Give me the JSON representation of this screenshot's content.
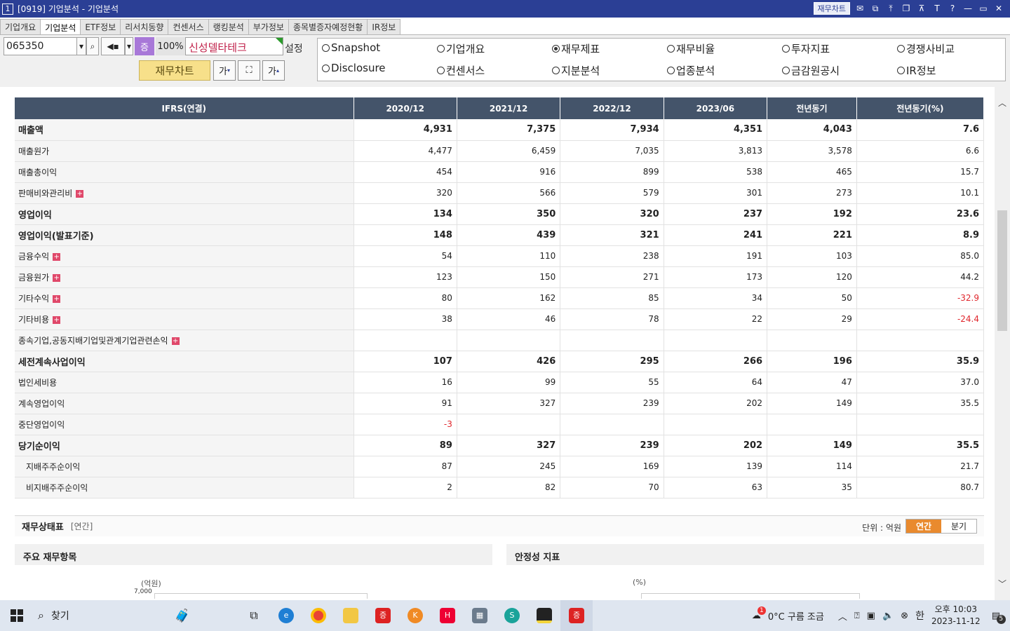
{
  "window": {
    "number": "1",
    "title": "[0919] 기업분석 - 기업분석",
    "chart_button": "재무차트"
  },
  "tabs": [
    "기업개요",
    "기업분석",
    "ETF정보",
    "리서치동향",
    "컨센서스",
    "랭킹분석",
    "부가정보",
    "종목별증자예정현황",
    "IR정보"
  ],
  "controls": {
    "code": "065350",
    "zoom_icon": "증",
    "zoom_pct": "100%",
    "company": "신성델타테크",
    "settings": "설정",
    "fin_chart_button": "재무차트",
    "font_small": "가",
    "font_large": "가"
  },
  "radios": [
    {
      "label": "Snapshot",
      "selected": false
    },
    {
      "label": "기업개요",
      "selected": false
    },
    {
      "label": "재무제표",
      "selected": true
    },
    {
      "label": "재무비율",
      "selected": false
    },
    {
      "label": "투자지표",
      "selected": false
    },
    {
      "label": "경쟁사비교",
      "selected": false
    },
    {
      "label": "Disclosure",
      "selected": false
    },
    {
      "label": "컨센서스",
      "selected": false
    },
    {
      "label": "지분분석",
      "selected": false
    },
    {
      "label": "업종분석",
      "selected": false
    },
    {
      "label": "금감원공시",
      "selected": false
    },
    {
      "label": "IR정보",
      "selected": false
    }
  ],
  "table": {
    "headers": [
      "IFRS(연결)",
      "2020/12",
      "2021/12",
      "2022/12",
      "2023/06",
      "전년동기",
      "전년동기(%)"
    ],
    "rows": [
      {
        "label": "매출액",
        "bold": true,
        "plus": false,
        "values": [
          "4,931",
          "7,375",
          "7,934",
          "4,351",
          "4,043",
          "7.6"
        ]
      },
      {
        "label": "매출원가",
        "bold": false,
        "plus": false,
        "values": [
          "4,477",
          "6,459",
          "7,035",
          "3,813",
          "3,578",
          "6.6"
        ]
      },
      {
        "label": "매출총이익",
        "bold": false,
        "plus": false,
        "values": [
          "454",
          "916",
          "899",
          "538",
          "465",
          "15.7"
        ]
      },
      {
        "label": "판매비와관리비",
        "bold": false,
        "plus": true,
        "values": [
          "320",
          "566",
          "579",
          "301",
          "273",
          "10.1"
        ]
      },
      {
        "label": "영업이익",
        "bold": true,
        "plus": false,
        "values": [
          "134",
          "350",
          "320",
          "237",
          "192",
          "23.6"
        ]
      },
      {
        "label": "영업이익(발표기준)",
        "bold": true,
        "plus": false,
        "values": [
          "148",
          "439",
          "321",
          "241",
          "221",
          "8.9"
        ]
      },
      {
        "label": "금융수익",
        "bold": false,
        "plus": true,
        "values": [
          "54",
          "110",
          "238",
          "191",
          "103",
          "85.0"
        ]
      },
      {
        "label": "금융원가",
        "bold": false,
        "plus": true,
        "values": [
          "123",
          "150",
          "271",
          "173",
          "120",
          "44.2"
        ]
      },
      {
        "label": "기타수익",
        "bold": false,
        "plus": true,
        "values": [
          "80",
          "162",
          "85",
          "34",
          "50",
          "-32.9"
        ]
      },
      {
        "label": "기타비용",
        "bold": false,
        "plus": true,
        "values": [
          "38",
          "46",
          "78",
          "22",
          "29",
          "-24.4"
        ]
      },
      {
        "label": "종속기업,공동지배기업및관계기업관련손익",
        "bold": false,
        "plus": true,
        "values": [
          "",
          "",
          "",
          "",
          "",
          ""
        ]
      },
      {
        "label": "세전계속사업이익",
        "bold": true,
        "plus": false,
        "values": [
          "107",
          "426",
          "295",
          "266",
          "196",
          "35.9"
        ]
      },
      {
        "label": "법인세비용",
        "bold": false,
        "plus": false,
        "values": [
          "16",
          "99",
          "55",
          "64",
          "47",
          "37.0"
        ]
      },
      {
        "label": "계속영업이익",
        "bold": false,
        "plus": false,
        "values": [
          "91",
          "327",
          "239",
          "202",
          "149",
          "35.5"
        ]
      },
      {
        "label": "중단영업이익",
        "bold": false,
        "plus": false,
        "values": [
          "-3",
          "",
          "",
          "",
          "",
          ""
        ]
      },
      {
        "label": "당기순이익",
        "bold": true,
        "plus": false,
        "values": [
          "89",
          "327",
          "239",
          "202",
          "149",
          "35.5"
        ]
      },
      {
        "label": "지배주주순이익",
        "bold": false,
        "plus": false,
        "indent": true,
        "values": [
          "87",
          "245",
          "169",
          "139",
          "114",
          "21.7"
        ]
      },
      {
        "label": "비지배주주순이익",
        "bold": false,
        "plus": false,
        "indent": true,
        "values": [
          "2",
          "82",
          "70",
          "63",
          "35",
          "80.7"
        ]
      }
    ]
  },
  "balance": {
    "title": "재무상태표",
    "subtitle": "[연간]",
    "unit": "단위 : 억원",
    "toggle_on": "연간",
    "toggle_off": "분기",
    "left_panel": "주요 재무항목",
    "left_unit": "(억원)",
    "left_top_tick": "7,000",
    "right_panel": "안정성 지표",
    "right_unit": "(%)"
  },
  "taskbar": {
    "search": "찾기",
    "weather": "0°C  구름 조금",
    "weather_badge": "1",
    "ime": "한",
    "time": "오후 10:03",
    "date": "2023-11-12",
    "notif_count": "5"
  },
  "colors": {
    "titlebar": "#2b3f95",
    "table_header": "#44546a",
    "negative": "#e0262c",
    "plus_badge": "#e0486a",
    "toggle_active": "#e98a2e"
  }
}
